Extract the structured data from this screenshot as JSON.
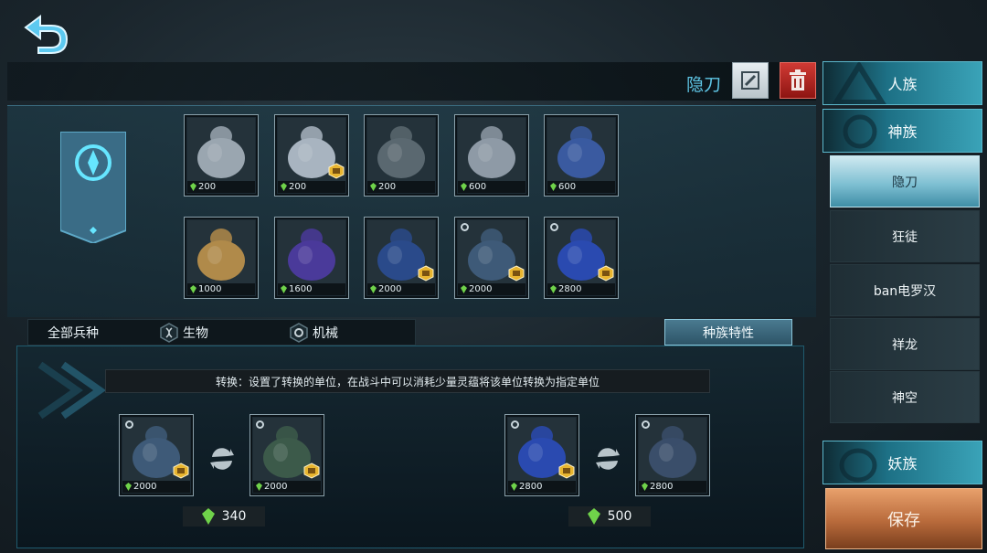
{
  "header": {
    "deck_name": "隐刀",
    "back_icon": "back-arrow-icon",
    "edit_icon": "pencil-icon",
    "delete_icon": "trash-icon"
  },
  "units": [
    {
      "cost": "200",
      "color": "#9aa6b0",
      "badge": false,
      "corner": false
    },
    {
      "cost": "200",
      "color": "#a8b4c0",
      "badge": true,
      "corner": false
    },
    {
      "cost": "200",
      "color": "#5a6870",
      "badge": false,
      "corner": false
    },
    {
      "cost": "600",
      "color": "#8e9aa6",
      "badge": false,
      "corner": false
    },
    {
      "cost": "600",
      "color": "#3a5aa0",
      "badge": false,
      "corner": false
    },
    {
      "cost": "1000",
      "color": "#b08a4a",
      "badge": false,
      "corner": false
    },
    {
      "cost": "1600",
      "color": "#4a3a9a",
      "badge": false,
      "corner": false
    },
    {
      "cost": "2000",
      "color": "#2a4a8a",
      "badge": true,
      "corner": false
    },
    {
      "cost": "2000",
      "color": "#3e5a78",
      "badge": true,
      "corner": true
    },
    {
      "cost": "2800",
      "color": "#2a4ab0",
      "badge": true,
      "corner": true
    }
  ],
  "filters": {
    "all": "全部兵种",
    "bio": "生物",
    "mech": "机械"
  },
  "trait_button": "种族特性",
  "description": "转换：设置了转换的单位，在战斗中可以消耗少量灵蕴将该单位转换为指定单位",
  "conversions": [
    {
      "from_cost": "2000",
      "to_cost": "2000",
      "price": "340"
    },
    {
      "from_cost": "2800",
      "to_cost": "2800",
      "price": "500"
    }
  ],
  "races": {
    "human": "人族",
    "divine": "神族",
    "demon": "妖族"
  },
  "subtabs": [
    "隐刀",
    "狂徒",
    "ban电罗汉",
    "祥龙",
    "神空"
  ],
  "save": "保存",
  "colors": {
    "accent": "#5fc6e6",
    "gem": "#6fd24a",
    "gold": "#e8b530"
  }
}
